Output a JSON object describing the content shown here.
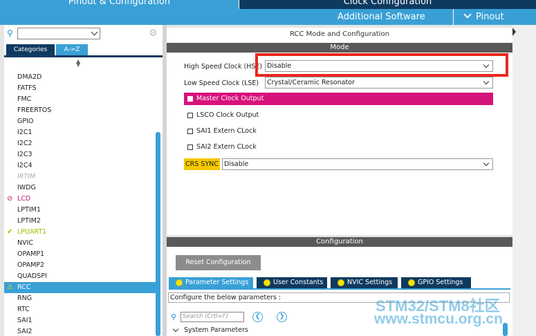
{
  "top_tabs": {
    "pinout_config": "Pinout & Configuration",
    "clock_config": "Clock Configuration"
  },
  "subbar": {
    "additional_software": "Additional Software",
    "pinout": "Pinout"
  },
  "left": {
    "categories_tab": "Categories",
    "az_tab": "A->Z",
    "peripherals": [
      {
        "name": "DMA2D",
        "state": "normal"
      },
      {
        "name": "FATFS",
        "state": "normal"
      },
      {
        "name": "FMC",
        "state": "normal"
      },
      {
        "name": "FREERTOS",
        "state": "normal"
      },
      {
        "name": "GPIO",
        "state": "normal"
      },
      {
        "name": "I2C1",
        "state": "normal"
      },
      {
        "name": "I2C2",
        "state": "normal"
      },
      {
        "name": "I2C3",
        "state": "normal"
      },
      {
        "name": "I2C4",
        "state": "normal"
      },
      {
        "name": "IRTIM",
        "state": "disabled"
      },
      {
        "name": "IWDG",
        "state": "normal"
      },
      {
        "name": "LCD",
        "state": "error"
      },
      {
        "name": "LPTIM1",
        "state": "normal"
      },
      {
        "name": "LPTIM2",
        "state": "normal"
      },
      {
        "name": "LPUART1",
        "state": "ok"
      },
      {
        "name": "NVIC",
        "state": "normal"
      },
      {
        "name": "OPAMP1",
        "state": "normal"
      },
      {
        "name": "OPAMP2",
        "state": "normal"
      },
      {
        "name": "QUADSPI",
        "state": "normal"
      },
      {
        "name": "RCC",
        "state": "selected-warning"
      },
      {
        "name": "RNG",
        "state": "normal"
      },
      {
        "name": "RTC",
        "state": "normal"
      },
      {
        "name": "SAI1",
        "state": "normal"
      },
      {
        "name": "SAI2",
        "state": "normal"
      }
    ]
  },
  "mode_panel": {
    "title": "RCC Mode and Configuration",
    "mode_header": "Mode",
    "hse_label": "High Speed Clock (HSE)",
    "hse_value": "Disable",
    "lse_label": "Low Speed Clock (LSE)",
    "lse_value": "Crystal/Ceramic Resonator",
    "master_clock_output": "Master Clock Output",
    "lsco": "LSCO Clock Output",
    "sai1": "SAI1 Extern CLock",
    "sai2": "SAI2 Extern CLock",
    "crs_label": "CRS SYNC",
    "crs_value": "Disable"
  },
  "config_panel": {
    "header": "Configuration",
    "reset": "Reset Configuration",
    "tabs": [
      "Parameter Settings",
      "User Constants",
      "NVIC Settings",
      "GPIO Settings"
    ],
    "description": "Configure the below parameters :",
    "search_placeholder": "Search (Crtl+F)",
    "system_parameters": "System Parameters"
  },
  "watermark": {
    "line1": "STM32/STM8社区",
    "line2": "www.stmcu.org.cn"
  },
  "colors": {
    "accent": "#39a0d6",
    "dark_tab": "#0f3a60",
    "error_pink": "#d6127b",
    "highlight_red": "#e8281e",
    "crs_yellow": "#f5c800"
  }
}
